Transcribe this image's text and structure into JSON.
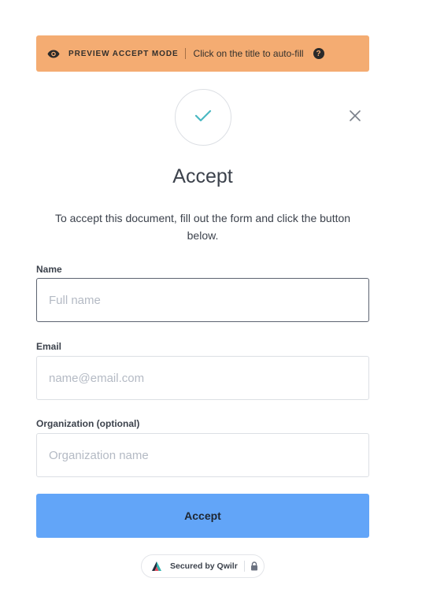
{
  "banner": {
    "mode_label": "PREVIEW ACCEPT MODE",
    "hint": "Click on the title to auto-fill",
    "help_symbol": "?",
    "color": "#f4ac72"
  },
  "dialog": {
    "title": "Accept",
    "description": "To accept this document, fill out the form and click the button below.",
    "check_color": "#4ab8c2"
  },
  "form": {
    "name": {
      "label": "Name",
      "placeholder": "Full name",
      "value": ""
    },
    "email": {
      "label": "Email",
      "placeholder": "name@email.com",
      "value": ""
    },
    "organization": {
      "label": "Organization (optional)",
      "placeholder": "Organization name",
      "value": ""
    }
  },
  "submit": {
    "label": "Accept",
    "color": "#62a5f8"
  },
  "footer": {
    "secured_text": "Secured by Qwilr"
  },
  "icons": {
    "banner_eye": "eye-icon",
    "banner_help": "help-icon",
    "check": "checkmark-icon",
    "close": "close-icon",
    "brand": "qwilr-logo-icon",
    "lock": "lock-icon"
  }
}
